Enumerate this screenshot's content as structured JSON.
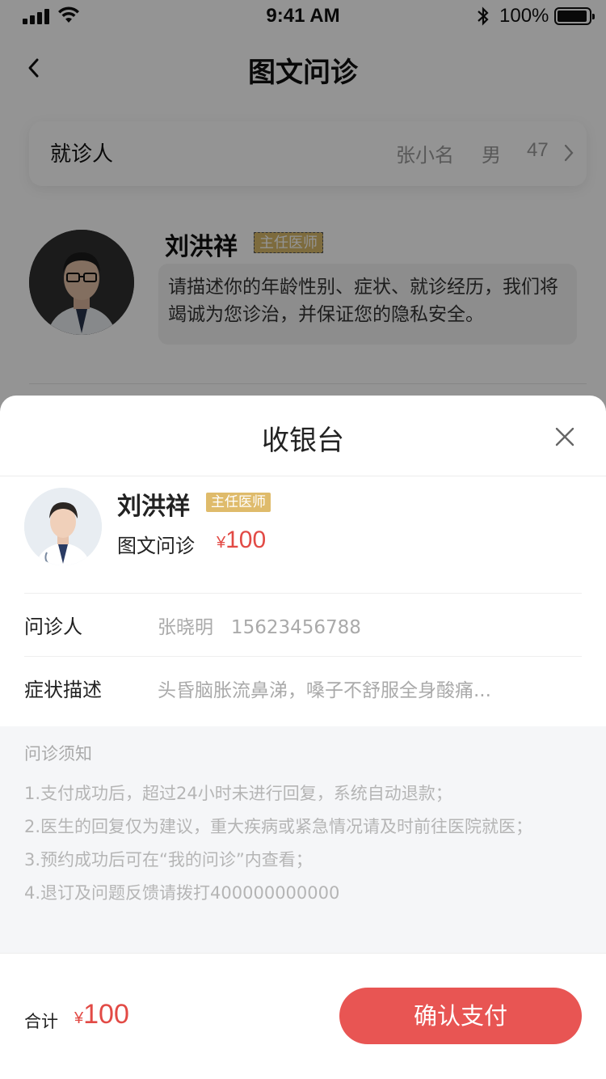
{
  "status_bar": {
    "time": "9:41 AM",
    "battery": "100%"
  },
  "nav": {
    "title": "图文问诊"
  },
  "patient": {
    "label": "就诊人",
    "name": "张小名",
    "gender": "男",
    "age": "47"
  },
  "doctor_card": {
    "name": "刘洪祥",
    "title": "主任医师",
    "message": "请描述你的年龄性别、症状、就诊经历，我们将竭诚为您诊治，并保证您的隐私安全。"
  },
  "sheet": {
    "title": "收银台",
    "doctor": {
      "name": "刘洪祥",
      "title": "主任医师"
    },
    "service": {
      "name": "图文问诊",
      "currency": "¥",
      "price": "100"
    },
    "rows": [
      {
        "label": "问诊人",
        "value": "张晓明   15623456788"
      },
      {
        "label": "症状描述",
        "value": "头昏脑胀流鼻涕，嗓子不舒服全身酸痛..."
      }
    ],
    "notice": {
      "title": "问诊须知",
      "items": [
        "1.支付成功后，超过24小时未进行回复，系统自动退款；",
        "2.医生的回复仅为建议，重大疾病或紧急情况请及时前往医院就医；",
        "3.预约成功后可在“我的问诊”内查看；",
        "4.退订及问题反馈请拨打400000000000"
      ]
    },
    "footer": {
      "total_label": "合计",
      "currency": "¥",
      "total": "100",
      "pay_label": "确认支付"
    }
  },
  "colors": {
    "accent": "#e85553",
    "price": "#e24a45",
    "badge": "#dfbb6b"
  }
}
